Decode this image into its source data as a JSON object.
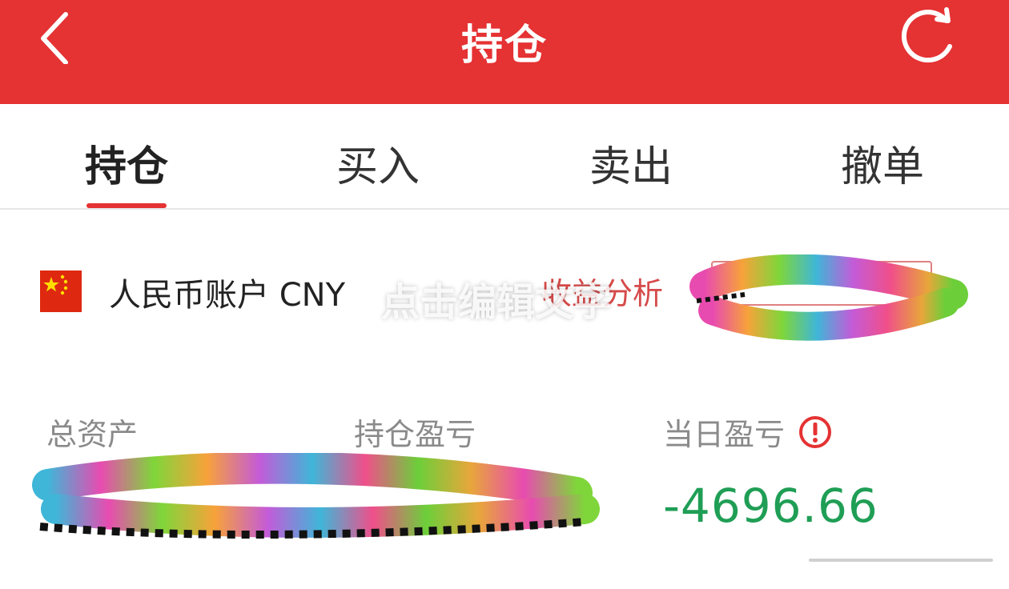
{
  "header": {
    "title": "持仓",
    "back_icon": "back-chevron-icon",
    "refresh_icon": "refresh-icon",
    "bg_color": "#e53233"
  },
  "tabs": [
    {
      "label": "持仓",
      "active": true
    },
    {
      "label": "买入",
      "active": false
    },
    {
      "label": "卖出",
      "active": false
    },
    {
      "label": "撤单",
      "active": false
    }
  ],
  "account": {
    "flag_icon": "china-flag-icon",
    "name": "人民币账户 CNY",
    "analysis_label": "收益分析",
    "analysis_pct": "%"
  },
  "watermark": "点击编辑文字",
  "summary": {
    "total_assets_label": "总资产",
    "holding_pl_label": "持仓盈亏",
    "day_pl_label": "当日盈亏",
    "day_pl_value": "-4696.66",
    "day_pl_color": "#1f9e55"
  }
}
